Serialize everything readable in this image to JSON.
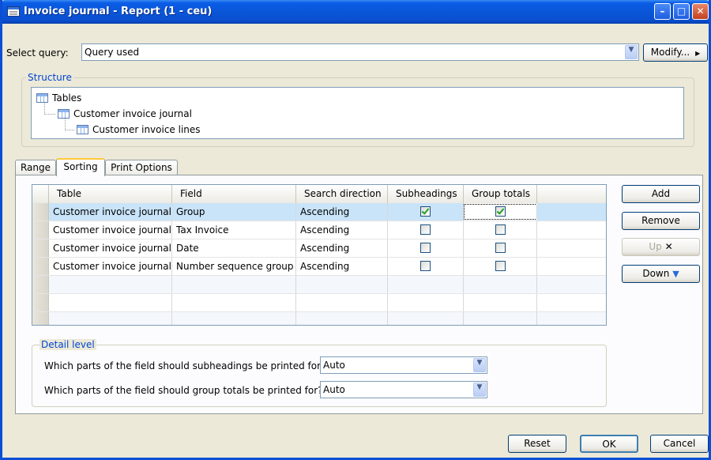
{
  "window": {
    "title": "Invoice journal - Report (1 - ceu)",
    "controls": [
      "minimize",
      "maximize",
      "close"
    ]
  },
  "query": {
    "label": "Select query:",
    "value": "Query used",
    "modify_button": "Modify..."
  },
  "structure": {
    "label": "Structure",
    "nodes": [
      {
        "label": "Tables",
        "icon": "tables-icon"
      },
      {
        "label": "Customer invoice journal",
        "icon": "table-icon"
      },
      {
        "label": "Customer invoice lines",
        "icon": "table-icon"
      }
    ]
  },
  "tabs": [
    {
      "label": "Range",
      "active": false
    },
    {
      "label": "Sorting",
      "active": true
    },
    {
      "label": "Print Options",
      "active": false
    }
  ],
  "sorting_grid": {
    "columns": [
      "Table",
      "Field",
      "Search direction",
      "Subheadings",
      "Group totals"
    ],
    "rows": [
      {
        "table": "Customer invoice journal",
        "field": "Group",
        "direction": "Ascending",
        "subheadings": true,
        "group_totals": true,
        "selected": true
      },
      {
        "table": "Customer invoice journal",
        "field": "Tax Invoice",
        "direction": "Ascending",
        "subheadings": false,
        "group_totals": false,
        "selected": false
      },
      {
        "table": "Customer invoice journal",
        "field": "Date",
        "direction": "Ascending",
        "subheadings": false,
        "group_totals": false,
        "selected": false
      },
      {
        "table": "Customer invoice journal",
        "field": "Number sequence group",
        "direction": "Ascending",
        "subheadings": false,
        "group_totals": false,
        "selected": false
      }
    ]
  },
  "side_buttons": {
    "add": "Add",
    "remove": "Remove",
    "up": "Up",
    "down": "Down"
  },
  "detail_level": {
    "label": "Detail level",
    "subheadings_question": "Which parts of the field should subheadings be printed for?",
    "subheadings_value": "Auto",
    "totals_question": "Which parts of the field should group totals be printed for?",
    "totals_value": "Auto"
  },
  "footer": {
    "reset": "Reset",
    "ok": "OK",
    "cancel": "Cancel"
  },
  "colors": {
    "titlebar": "#0a56d8",
    "selected_row": "#c9e4f9",
    "group_label": "#0046d5"
  }
}
